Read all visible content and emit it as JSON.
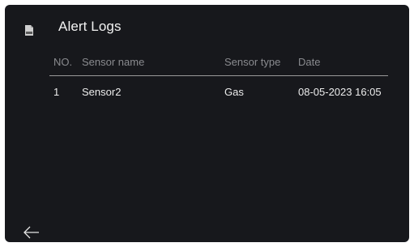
{
  "header": {
    "icon": "log-document-icon",
    "title": "Alert Logs"
  },
  "table": {
    "columns": [
      "NO.",
      "Sensor name",
      "Sensor type",
      "Date"
    ],
    "rows": [
      {
        "no": "1",
        "sensor_name": "Sensor2",
        "sensor_type": "Gas",
        "date": "08-05-2023 16:05"
      }
    ]
  },
  "footer": {
    "back_icon": "arrow-left-icon"
  },
  "colors": {
    "background": "#17181c",
    "text": "#ececec",
    "muted_text": "#8a8b8f",
    "divider": "#9a9a9a"
  }
}
